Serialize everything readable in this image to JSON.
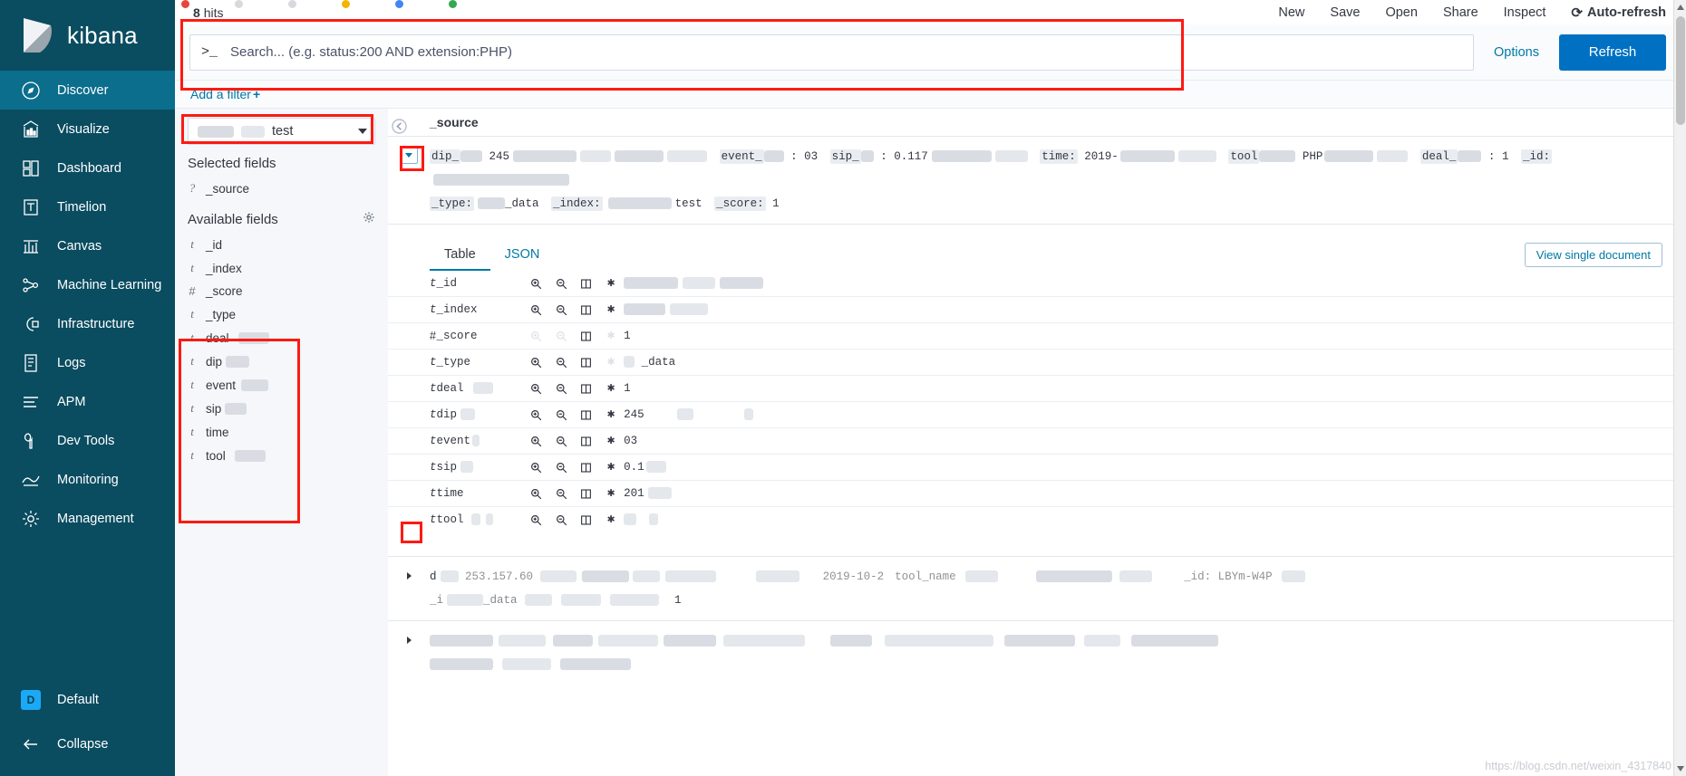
{
  "brand": {
    "name": "kibana",
    "logo_icon": "kibana-logo"
  },
  "sidebar": {
    "items": [
      {
        "label": "Discover",
        "icon": "compass-icon",
        "active": true
      },
      {
        "label": "Visualize",
        "icon": "bar-chart-icon",
        "active": false
      },
      {
        "label": "Dashboard",
        "icon": "dashboard-grid-icon",
        "active": false
      },
      {
        "label": "Timelion",
        "icon": "timelion-icon",
        "active": false
      },
      {
        "label": "Canvas",
        "icon": "canvas-icon",
        "active": false
      },
      {
        "label": "Machine Learning",
        "icon": "machine-learning-icon",
        "active": false
      },
      {
        "label": "Infrastructure",
        "icon": "infrastructure-icon",
        "active": false
      },
      {
        "label": "Logs",
        "icon": "logs-icon",
        "active": false
      },
      {
        "label": "APM",
        "icon": "apm-icon",
        "active": false
      },
      {
        "label": "Dev Tools",
        "icon": "wrench-icon",
        "active": false
      },
      {
        "label": "Monitoring",
        "icon": "monitoring-icon",
        "active": false
      },
      {
        "label": "Management",
        "icon": "gear-icon",
        "active": false
      }
    ],
    "space": {
      "badge": "D",
      "label": "Default"
    },
    "collapse": {
      "label": "Collapse",
      "icon": "arrow-left-icon"
    }
  },
  "topbar": {
    "hits_count": "8",
    "hits_label": "hits",
    "menu": [
      {
        "label": "New",
        "icon": ""
      },
      {
        "label": "Save",
        "icon": ""
      },
      {
        "label": "Open",
        "icon": ""
      },
      {
        "label": "Share",
        "icon": ""
      },
      {
        "label": "Inspect",
        "icon": ""
      }
    ],
    "auto_refresh": {
      "label": "Auto-refresh",
      "glyph": "↻",
      "icon": "refresh-icon"
    }
  },
  "query": {
    "prompt_glyph": ">_",
    "value": "",
    "placeholder": "Search... (e.g. status:200 AND extension:PHP)",
    "options_label": "Options",
    "refresh_label": "Refresh"
  },
  "filters": {
    "add_label": "Add a filter",
    "plus": "+"
  },
  "fields": {
    "index_pattern": {
      "value": "test",
      "redacted_prefix": true
    },
    "selected_title": "Selected fields",
    "selected": [
      {
        "type": "?",
        "name": "_source"
      }
    ],
    "available_title": "Available fields",
    "settings_icon": "gear-icon",
    "available": [
      {
        "type": "t",
        "name": "_id",
        "redacted": false
      },
      {
        "type": "t",
        "name": "_index",
        "redacted": false
      },
      {
        "type": "#",
        "name": "_score",
        "redacted": false
      },
      {
        "type": "t",
        "name": "_type",
        "redacted": false
      },
      {
        "type": "t",
        "name": "deal",
        "redacted": true
      },
      {
        "type": "t",
        "name": "dip",
        "redacted": true
      },
      {
        "type": "t",
        "name": "event",
        "redacted": true
      },
      {
        "type": "t",
        "name": "sip",
        "redacted": true
      },
      {
        "type": "t",
        "name": "time",
        "redacted": false
      },
      {
        "type": "t",
        "name": "tool",
        "redacted": true
      }
    ]
  },
  "doc_table": {
    "column_header": "_source",
    "collapse_icon": "collapse-left-icon",
    "rows": [
      {
        "expanded": true,
        "source_line1": [
          {
            "key": "dip_",
            "value": "245",
            "redacted_after_key": true,
            "redacted_after_value": true
          },
          {
            "key": "event_",
            "value": "03",
            "redacted_after_key": true,
            "redacted_after_value": false
          },
          {
            "key": "sip_",
            "value": "0.117",
            "redacted_after_key": true,
            "redacted_after_value": true
          },
          {
            "key": "time:",
            "value": "2019-",
            "redacted_after_key": false,
            "redacted_after_value": true
          },
          {
            "key": "tool",
            "value": "PHP",
            "redacted_after_key": true,
            "redacted_after_value": true
          },
          {
            "key": "deal_",
            "value": "1",
            "redacted_after_key": true,
            "redacted_after_value": false
          },
          {
            "key": "_id:",
            "value": "",
            "redacted_after_key": false,
            "redacted_after_value": true
          }
        ],
        "source_line2": [
          {
            "key": "_type:",
            "value": "_data",
            "redacted_after_key": true,
            "redacted_after_value": false
          },
          {
            "key": "_index:",
            "value": "test",
            "redacted_after_key": true,
            "redacted_after_value": false
          },
          {
            "key": "_score:",
            "value": "1",
            "redacted_after_key": false,
            "redacted_after_value": false
          }
        ]
      }
    ],
    "detail": {
      "tabs": [
        {
          "label": "Table",
          "active": true
        },
        {
          "label": "JSON",
          "active": false
        }
      ],
      "view_single_document": "View single document",
      "action_icons": [
        "magnify-plus-icon",
        "magnify-minus-icon",
        "toggle-column-icon",
        "filter-for-field-present-icon"
      ],
      "fields": [
        {
          "type": "t",
          "name": "_id",
          "value": "",
          "redacted": true,
          "dim_actions": false
        },
        {
          "type": "t",
          "name": "_index",
          "value": "",
          "redacted": true,
          "dim_actions": false
        },
        {
          "type": "#",
          "name": "_score",
          "value": "1",
          "redacted": false,
          "dim_actions": true
        },
        {
          "type": "t",
          "name": "_type",
          "value": "_data",
          "redacted": false,
          "dim_actions": true
        },
        {
          "type": "t",
          "name": "deal",
          "value": "1",
          "redacted": true,
          "dim_actions": false
        },
        {
          "type": "t",
          "name": "dip",
          "value": "245",
          "redacted": true,
          "dim_actions": false
        },
        {
          "type": "t",
          "name": "event",
          "value": "03",
          "redacted": true,
          "dim_actions": false
        },
        {
          "type": "t",
          "name": "sip",
          "value": "0.1",
          "redacted": true,
          "dim_actions": false
        },
        {
          "type": "t",
          "name": "time",
          "value": "201",
          "redacted": false,
          "dim_actions": false
        },
        {
          "type": "t",
          "name": "tool",
          "value": "",
          "redacted": true,
          "dim_actions": false
        }
      ]
    },
    "row2": {
      "text_a": "d",
      "text_b": "253.157.60",
      "text_c": "2019-10-2",
      "text_d": "tool_name",
      "text_e": "_id: LBYm-W4P",
      "line2_a": "_i",
      "line2_b": "_data",
      "line2_c": "1"
    }
  },
  "watermark": "https://blog.csdn.net/weixin_4317840",
  "colors": {
    "sidebar_bg": "#0a4c60",
    "sidebar_active": "#0b6e8d",
    "accent_link": "#0079a5",
    "primary_button": "#0071c2",
    "annotation_red": "#fc1a12"
  }
}
